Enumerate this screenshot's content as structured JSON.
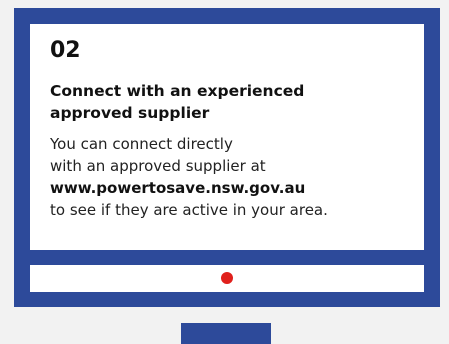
{
  "card": {
    "step_number": "02",
    "heading_line1": "Connect with an experienced",
    "heading_line2": "approved supplier",
    "body_line1": "You can connect directly",
    "body_line2": "with an approved supplier at",
    "url": "www.powertosave.nsw.gov.au",
    "body_line4": "to see if they are active in your area."
  },
  "colors": {
    "monitor_frame": "#2d4a9a",
    "screen": "#ffffff",
    "power_indicator": "#e0201c",
    "background": "#f2f2f2"
  }
}
